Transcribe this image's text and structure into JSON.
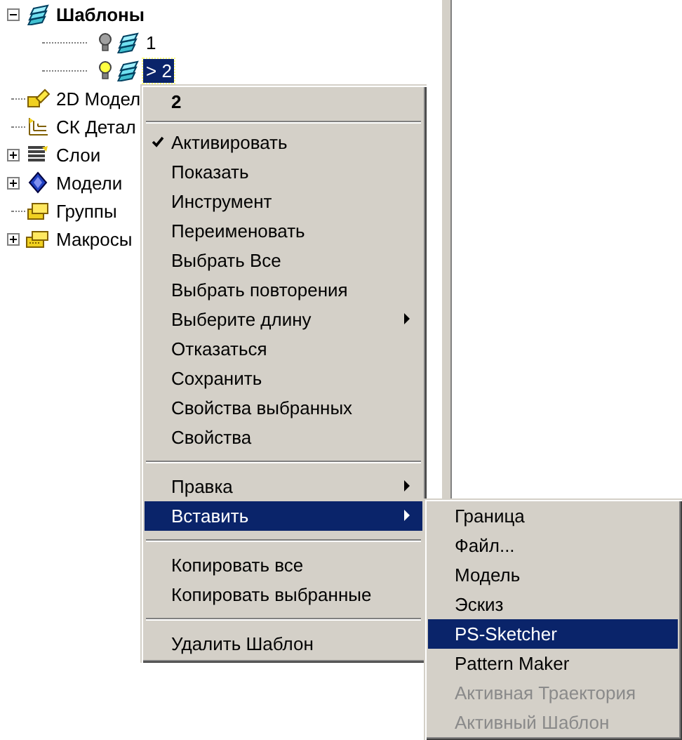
{
  "tree": [
    {
      "label": "Шаблоны",
      "expanded": true,
      "children": [
        {
          "label": "1",
          "lit": false,
          "selected": false
        },
        {
          "label": "> 2",
          "lit": true,
          "selected": true
        }
      ]
    },
    {
      "label": "2D Модел"
    },
    {
      "label": "СК Детал"
    },
    {
      "label": "Слои",
      "expanded": false
    },
    {
      "label": "Модели",
      "expanded": false
    },
    {
      "label": "Группы"
    },
    {
      "label": "Макросы",
      "expanded": false
    }
  ],
  "context_menu": {
    "title": "2",
    "items": [
      {
        "kind": "item",
        "label": "Активировать",
        "checked": true,
        "submenu": false,
        "selected": false
      },
      {
        "kind": "item",
        "label": "Показать",
        "checked": false,
        "submenu": false,
        "selected": false
      },
      {
        "kind": "item",
        "label": "Инструмент",
        "checked": false,
        "submenu": false,
        "selected": false
      },
      {
        "kind": "item",
        "label": "Переименовать",
        "checked": false,
        "submenu": false,
        "selected": false
      },
      {
        "kind": "item",
        "label": "Выбрать Все",
        "checked": false,
        "submenu": false,
        "selected": false
      },
      {
        "kind": "item",
        "label": "Выбрать повторения",
        "checked": false,
        "submenu": false,
        "selected": false
      },
      {
        "kind": "item",
        "label": "Выберите длину",
        "checked": false,
        "submenu": true,
        "selected": false
      },
      {
        "kind": "item",
        "label": "Отказаться",
        "checked": false,
        "submenu": false,
        "selected": false
      },
      {
        "kind": "item",
        "label": "Сохранить",
        "checked": false,
        "submenu": false,
        "selected": false
      },
      {
        "kind": "item",
        "label": "Свойства выбранных",
        "checked": false,
        "submenu": false,
        "selected": false
      },
      {
        "kind": "item",
        "label": "Свойства",
        "checked": false,
        "submenu": false,
        "selected": false
      },
      {
        "kind": "separator"
      },
      {
        "kind": "item",
        "label": "Правка",
        "checked": false,
        "submenu": true,
        "selected": false
      },
      {
        "kind": "item",
        "label": "Вставить",
        "checked": false,
        "submenu": true,
        "selected": true
      },
      {
        "kind": "separator"
      },
      {
        "kind": "item",
        "label": "Копировать все",
        "checked": false,
        "submenu": false,
        "selected": false
      },
      {
        "kind": "item",
        "label": "Копировать выбранные",
        "checked": false,
        "submenu": false,
        "selected": false
      },
      {
        "kind": "separator"
      },
      {
        "kind": "item",
        "label": "Удалить Шаблон",
        "checked": false,
        "submenu": false,
        "selected": false
      }
    ]
  },
  "submenu": {
    "items": [
      {
        "label": "Граница",
        "selected": false,
        "disabled": false
      },
      {
        "label": "Файл...",
        "selected": false,
        "disabled": false
      },
      {
        "label": "Модель",
        "selected": false,
        "disabled": false
      },
      {
        "label": "Эскиз",
        "selected": false,
        "disabled": false
      },
      {
        "label": "PS-Sketcher",
        "selected": true,
        "disabled": false
      },
      {
        "label": "Pattern Maker",
        "selected": false,
        "disabled": false
      },
      {
        "label": "Активная Траектория",
        "selected": false,
        "disabled": true
      },
      {
        "label": "Активный Шаблон",
        "selected": false,
        "disabled": true
      }
    ]
  }
}
